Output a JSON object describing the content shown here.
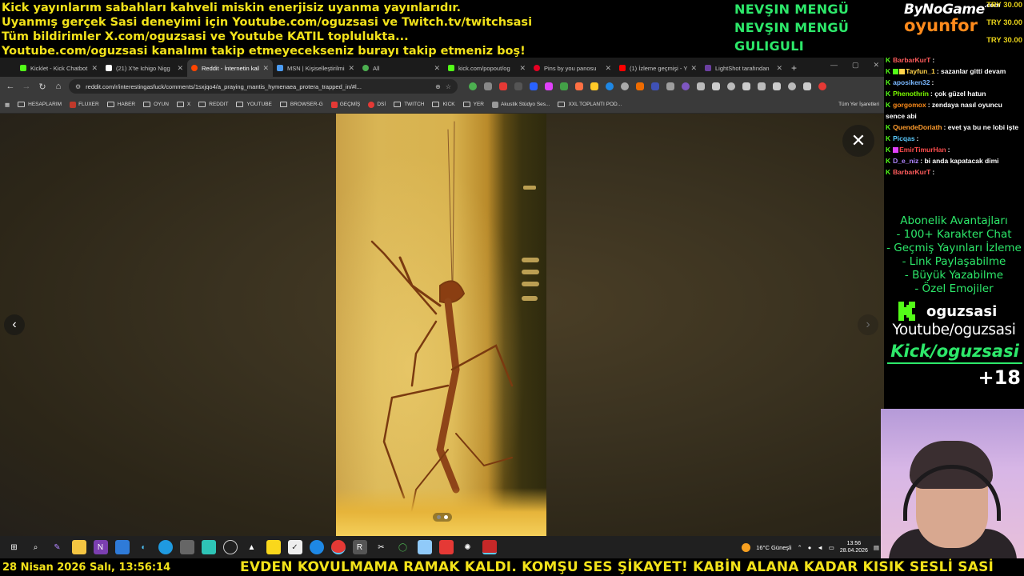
{
  "overlay": {
    "banner_lines": [
      "Kick yayınlarım sabahları kahveli miskin enerjisiz uyanma yayınlarıdır.",
      "Uyanmış gerçek Sasi deneyimi için Youtube.com/oguzsasi ve Twitch.tv/twitchsasi",
      "Tüm bildirimler X.com/oguzsasi ve Youtube KATIL toplulukta...",
      "Youtube.com/oguzsasi kanalımı takip etmeyecekseniz burayı takip etmeniz boş!"
    ],
    "donors": [
      "NEVŞIN MENGÜ",
      "NEVŞIN MENGÜ",
      "GULIGULI"
    ],
    "sponsor_top": "ByNoGame",
    "sponsor_sup": ".com",
    "sponsor_bottom": "oyunfor",
    "amounts": [
      "TRY 30.00",
      "TRY 30.00",
      "TRY 30.00"
    ]
  },
  "browser": {
    "tabs": [
      {
        "label": "Kicklet - Kick Chatbot",
        "color": "#53fc18"
      },
      {
        "label": "(21) X'te Ichigo Nigg",
        "color": "#ffffff"
      },
      {
        "label": "Reddit - İnternetin kalbi",
        "color": "#ff4500"
      },
      {
        "label": "MSN | Kişiselleştirilmiş",
        "color": "#4b9cf5"
      },
      {
        "label": "All",
        "color": "#4caf50"
      },
      {
        "label": "kick.com/popout/og",
        "color": "#53fc18"
      },
      {
        "label": "Pins by you panosu",
        "color": "#e60023"
      },
      {
        "label": "(1) İzleme geçmişi - Y",
        "color": "#ff0000"
      },
      {
        "label": "LightShot tarafından",
        "color": "#6b3fa0"
      }
    ],
    "url": "reddit.com/r/interestingasfuck/comments/1sxjqo4/a_praying_mantis_hymenaea_protera_trapped_in/#l...",
    "bookmarks": [
      {
        "label": "HESAPLARIM",
        "kind": "folder"
      },
      {
        "label": "FLUXER",
        "kind": "site",
        "color": "#c0392b"
      },
      {
        "label": "HABER",
        "kind": "folder"
      },
      {
        "label": "OYUN",
        "kind": "folder"
      },
      {
        "label": "X",
        "kind": "folder"
      },
      {
        "label": "REDDIT",
        "kind": "folder"
      },
      {
        "label": "YOUTUBE",
        "kind": "folder"
      },
      {
        "label": "BROWSER-G",
        "kind": "folder"
      },
      {
        "label": "GEÇMİŞ",
        "kind": "site",
        "color": "#e53935"
      },
      {
        "label": "DSİ",
        "kind": "site",
        "color": "#e53935"
      },
      {
        "label": "TWITCH",
        "kind": "folder"
      },
      {
        "label": "KICK",
        "kind": "folder"
      },
      {
        "label": "YER",
        "kind": "folder"
      },
      {
        "label": "Akustik Stüdyo Ses...",
        "kind": "site",
        "color": "#999999"
      },
      {
        "label": "XXL TOPLANTI POD...",
        "kind": "folder"
      }
    ],
    "bookmarks_right": "Tüm Yer İşaretleri"
  },
  "viewer": {
    "close_glyph": "✕",
    "prev_glyph": "‹",
    "next_glyph": "›",
    "slide_count": 2,
    "active_slide": 2
  },
  "taskbar": {
    "weather": "16°C  Güneşli",
    "time": "13:56",
    "date": "28.04.2026"
  },
  "ticker": {
    "date": "28 Nisan 2026 Salı, 13:56:14",
    "message": "EVDEN KOVULMAMA RAMAK KALDI. KOMŞU SES ŞİKAYET! KABİN ALANA KADAR KISIK SESLİ SASİ"
  },
  "chat": {
    "messages": [
      {
        "user": "BarbarKurT",
        "color": "#ff5c5c",
        "text": ":"
      },
      {
        "user": "Tayfun_1",
        "color": "#ffd24a",
        "text": ": sazanlar gitti devam"
      },
      {
        "user": "aposiken32",
        "color": "#7ab8ff",
        "text": ":"
      },
      {
        "user": "Phenothrin",
        "color": "#7cfc00",
        "text": ": çok güzel hatun"
      },
      {
        "user": "gorgomox",
        "color": "#ff8c1a",
        "text": ": zendaya nasıl oyuncu sence abi"
      },
      {
        "user": "QuendeDoriath",
        "color": "#ff9d2e",
        "text": ": evet ya bu ne lobi işte"
      },
      {
        "user": "Picqas",
        "color": "#5ac8fa",
        "text": ":"
      },
      {
        "user": "EmirTimurHan",
        "color": "#ff4d4d",
        "text": ":"
      },
      {
        "user": "D_e_niz",
        "color": "#b085ff",
        "text": ": bi anda kapatacak dimi"
      },
      {
        "user": "BarbarKurT",
        "color": "#ff5c5c",
        "text": ":"
      }
    ]
  },
  "promo": {
    "lines": [
      "Abonelik Avantajları",
      "- 100+ Karakter Chat",
      "- Geçmiş Yayınları İzleme",
      "- Link Paylaşabilme",
      "- Büyük Yazabilme",
      "- Özel Emojiler"
    ]
  },
  "brand": {
    "name": "oguzsasi",
    "youtube": "Youtube/oguzsasi",
    "kick": "Kick/oguzsasi",
    "age": "+18"
  },
  "colors": {
    "banner_yellow": "#f2e21a",
    "kick_green": "#53fc18",
    "promo_green": "#2de86a"
  }
}
